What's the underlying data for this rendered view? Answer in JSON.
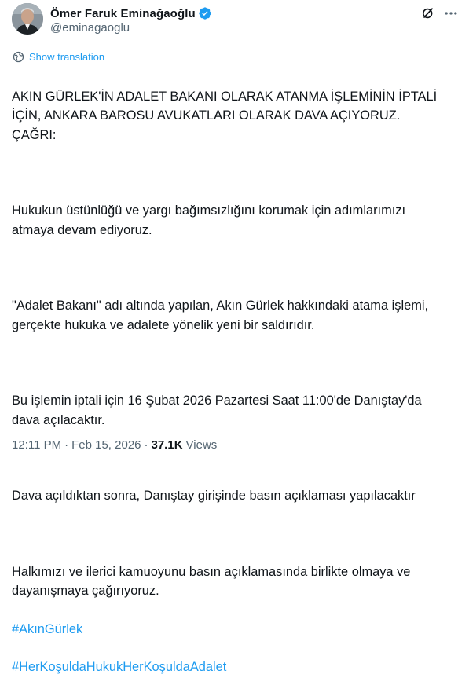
{
  "author": {
    "display_name": "Ömer Faruk Eminağaoğlu",
    "handle": "@eminagaoglu",
    "verified": true,
    "verified_color": "#1d9bf0"
  },
  "translate": {
    "label": "Show translation",
    "icon": "globe-icon"
  },
  "tweet": {
    "paragraphs": [
      [
        "AKIN GÜRLEK'İN ADALET BAKANI OLARAK ATANMA İŞLEMİNİN İPTALİ",
        "İÇİN, ANKARA BAROSU AVUKATLARI OLARAK DAVA AÇIYORUZ.",
        "ÇAĞRI:"
      ],
      [
        "Hukukun üstünlüğü ve yargı bağımsızlığını korumak için adımlarımızı",
        "atmaya devam ediyoruz."
      ],
      [
        "\"Adalet Bakanı\" adı altında yapılan,  Akın Gürlek hakkındaki atama işlemi,",
        "gerçekte hukuka ve adalete yönelik yeni bir saldırıdır."
      ],
      [
        "Bu işlemin iptali için 16 Şubat 2026 Pazartesi Saat 11:00'de Danıştay'da",
        "dava açılacaktır."
      ],
      [
        "Dava açıldıktan sonra, Danıştay girişinde basın açıklaması yapılacaktır"
      ],
      [
        "Halkımızı ve ilerici kamuoyunu basın açıklamasında birlikte olmaya ve",
        "dayanışmaya çağırıyoruz."
      ]
    ],
    "hashtags": [
      "#AkınGürlek",
      "#HerKoşuldaHukukHerKoşuldaAdalet"
    ]
  },
  "meta": {
    "time": "12:11 PM",
    "separator": "·",
    "date": "Feb 15, 2026",
    "views_count": "37.1K",
    "views_label": "Views"
  },
  "colors": {
    "text": "#0f1419",
    "secondary": "#536471",
    "accent": "#1d9bf0"
  }
}
